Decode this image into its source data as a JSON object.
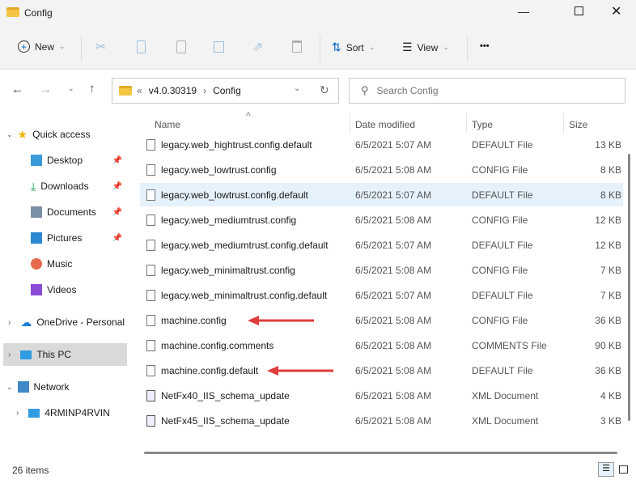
{
  "window": {
    "title": "Config",
    "controls": [
      "minimize",
      "maximize",
      "close"
    ]
  },
  "toolbar": {
    "new_label": "New",
    "sort_label": "Sort",
    "view_label": "View",
    "more_label": "•••",
    "icons": [
      "cut-icon",
      "copy-icon",
      "paste-icon",
      "rename-icon",
      "share-icon",
      "delete-icon"
    ]
  },
  "address": {
    "overflow": "«",
    "segments": [
      "v4.0.30319",
      "Config"
    ],
    "search_placeholder": "Search Config"
  },
  "nav": {
    "quick_access": "Quick access",
    "pinned": [
      "Desktop",
      "Downloads",
      "Documents",
      "Pictures"
    ],
    "items": [
      "Music",
      "Videos"
    ],
    "onedrive": "OneDrive - Personal",
    "this_pc": "This PC",
    "network": "Network",
    "computer": "4RMINP4RVIN"
  },
  "columns": {
    "name": "Name",
    "date": "Date modified",
    "type": "Type",
    "size": "Size"
  },
  "files": [
    {
      "name": "legacy.web_hightrust.config",
      "date": "6/5/2021 5:08 AM",
      "type": "CONFIG File",
      "size": "13 KB"
    },
    {
      "name": "legacy.web_hightrust.config.default",
      "date": "6/5/2021 5:07 AM",
      "type": "DEFAULT File",
      "size": "13 KB"
    },
    {
      "name": "legacy.web_lowtrust.config",
      "date": "6/5/2021 5:08 AM",
      "type": "CONFIG File",
      "size": "8 KB"
    },
    {
      "name": "legacy.web_lowtrust.config.default",
      "date": "6/5/2021 5:07 AM",
      "type": "DEFAULT File",
      "size": "8 KB",
      "selected": true
    },
    {
      "name": "legacy.web_mediumtrust.config",
      "date": "6/5/2021 5:08 AM",
      "type": "CONFIG File",
      "size": "12 KB"
    },
    {
      "name": "legacy.web_mediumtrust.config.default",
      "date": "6/5/2021 5:07 AM",
      "type": "DEFAULT File",
      "size": "12 KB"
    },
    {
      "name": "legacy.web_minimaltrust.config",
      "date": "6/5/2021 5:08 AM",
      "type": "CONFIG File",
      "size": "7 KB"
    },
    {
      "name": "legacy.web_minimaltrust.config.default",
      "date": "6/5/2021 5:07 AM",
      "type": "DEFAULT File",
      "size": "7 KB"
    },
    {
      "name": "machine.config",
      "date": "6/5/2021 5:08 AM",
      "type": "CONFIG File",
      "size": "36 KB",
      "arrow": true
    },
    {
      "name": "machine.config.comments",
      "date": "6/5/2021 5:08 AM",
      "type": "COMMENTS File",
      "size": "90 KB"
    },
    {
      "name": "machine.config.default",
      "date": "6/5/2021 5:08 AM",
      "type": "DEFAULT File",
      "size": "36 KB",
      "arrow": true
    },
    {
      "name": "NetFx40_IIS_schema_update",
      "date": "6/5/2021 5:08 AM",
      "type": "XML Document",
      "size": "4 KB"
    },
    {
      "name": "NetFx45_IIS_schema_update",
      "date": "6/5/2021 5:08 AM",
      "type": "XML Document",
      "size": "3 KB"
    }
  ],
  "status": {
    "count": "26 items"
  },
  "colors": {
    "accent": "#0067c0",
    "arrow": "#e03c3c",
    "selected": "#e5f1fb"
  }
}
